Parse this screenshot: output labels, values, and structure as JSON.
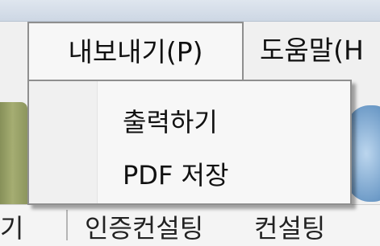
{
  "menubar": {
    "export_label": "내보내기(P)",
    "help_label": "도움말(H"
  },
  "export_menu": {
    "items": [
      {
        "label": "출력하기"
      },
      {
        "label": "PDF 저장"
      }
    ]
  },
  "toolbar": {
    "labels": [
      "기",
      "인증컨설팅",
      "컨설팅&#8203;"
    ]
  },
  "icons": {
    "left_tool": "trash-bin-icon",
    "right_tool": "globe-icon"
  }
}
